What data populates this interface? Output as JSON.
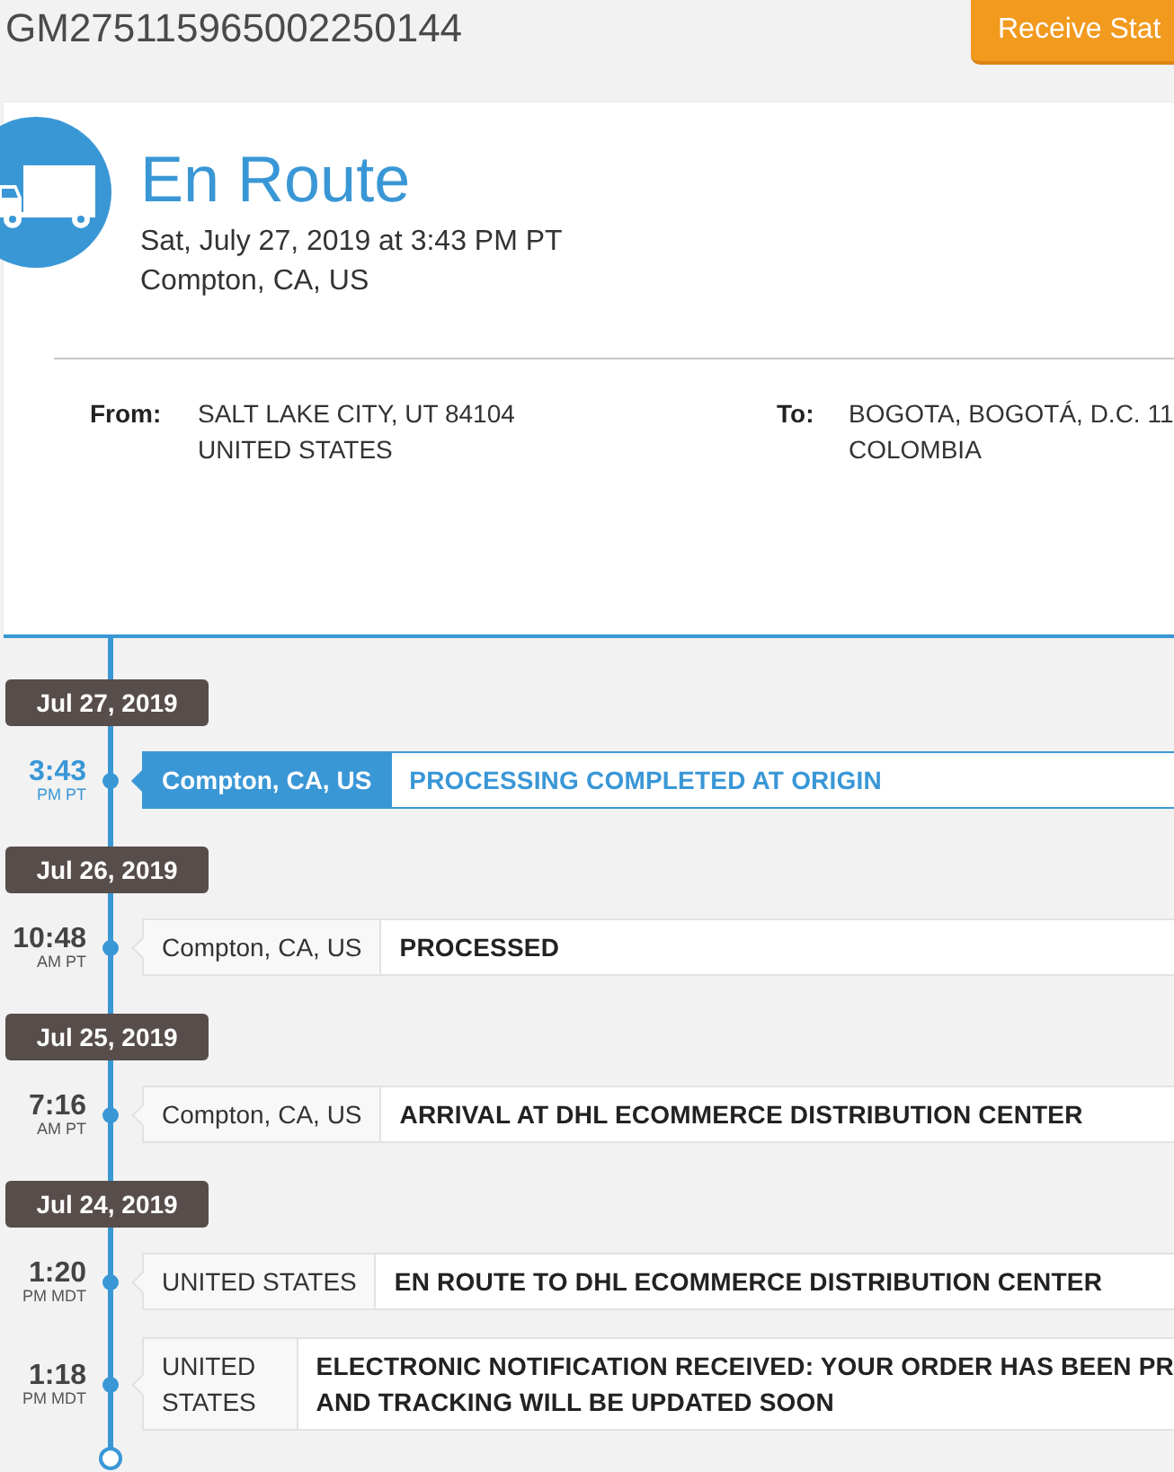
{
  "header": {
    "tracking_number": "GM275115965002250144",
    "button": "Receive Stat"
  },
  "status": {
    "title": "En Route",
    "datetime": "Sat, July 27, 2019 at 3:43 PM PT",
    "location": "Compton, CA, US"
  },
  "addresses": [
    {
      "label": "From:",
      "lines": [
        "SALT LAKE CITY, UT 84104",
        "UNITED STATES"
      ]
    },
    {
      "label": "To:",
      "lines": [
        "BOGOTA, BOGOTÁ, D.C. 11",
        "COLOMBIA"
      ]
    }
  ],
  "timeline": [
    {
      "date": "Jul 27, 2019",
      "events": [
        {
          "time": "3:43",
          "period": "PM PT",
          "location": "Compton, CA, US",
          "description": [
            "PROCESSING COMPLETED AT ORIGIN"
          ],
          "highlighted": true
        }
      ]
    },
    {
      "date": "Jul 26, 2019",
      "events": [
        {
          "time": "10:48",
          "period": "AM PT",
          "location": "Compton, CA, US",
          "description": [
            "PROCESSED"
          ],
          "highlighted": false
        }
      ]
    },
    {
      "date": "Jul 25, 2019",
      "events": [
        {
          "time": "7:16",
          "period": "AM PT",
          "location": "Compton, CA, US",
          "description": [
            "ARRIVAL AT DHL ECOMMERCE DISTRIBUTION CENTER"
          ],
          "highlighted": false
        }
      ]
    },
    {
      "date": "Jul 24, 2019",
      "events": [
        {
          "time": "1:20",
          "period": "PM MDT",
          "location": "UNITED STATES",
          "description": [
            "EN ROUTE TO DHL ECOMMERCE DISTRIBUTION CENTER"
          ],
          "highlighted": false
        },
        {
          "time": "1:18",
          "period": "PM MDT",
          "location": "UNITED STATES",
          "description": [
            "ELECTRONIC NOTIFICATION RECEIVED: YOUR ORDER HAS BEEN PR",
            "AND TRACKING WILL BE UPDATED SOON"
          ],
          "highlighted": false
        }
      ]
    }
  ]
}
